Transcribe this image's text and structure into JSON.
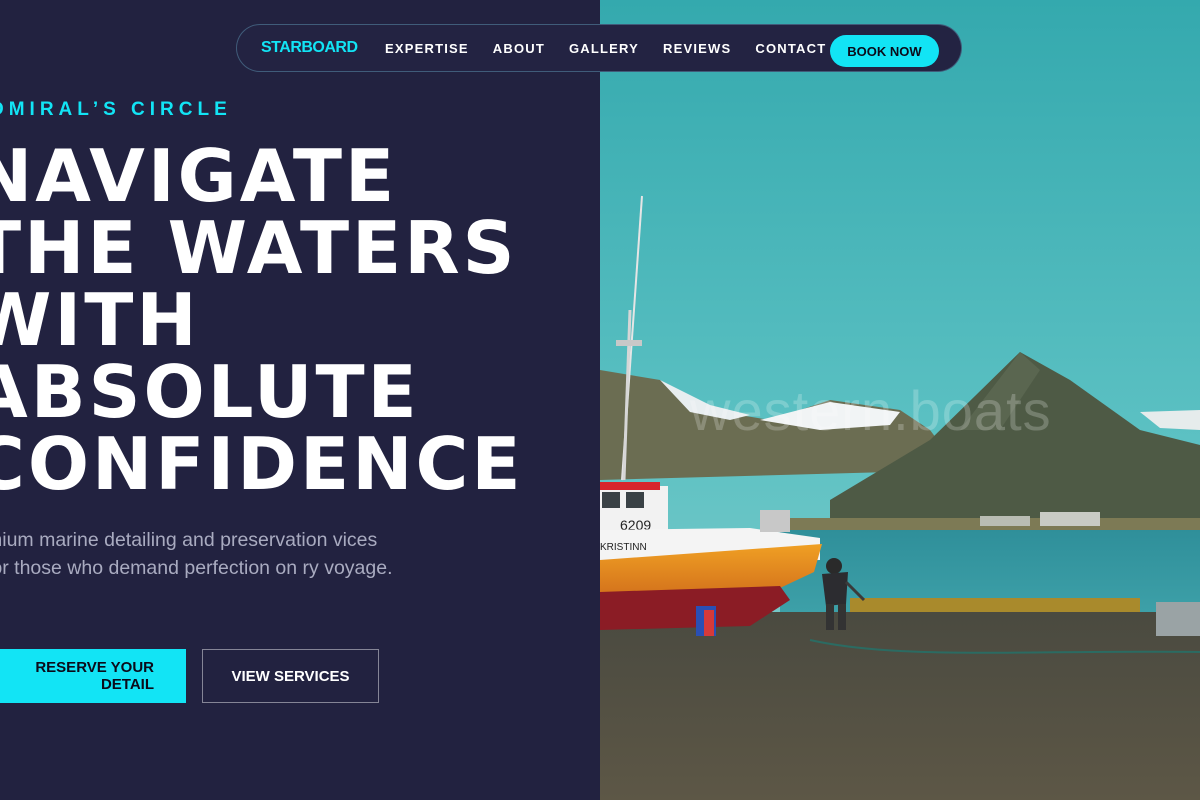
{
  "nav": {
    "brand": "STARBOARD",
    "links": [
      "EXPERTISE",
      "ABOUT",
      "GALLERY",
      "REVIEWS",
      "CONTACT"
    ],
    "cta": "BOOK NOW"
  },
  "hero": {
    "eyebrow": "DMIRAL’S CIRCLE",
    "headline": [
      "NAVIGATE",
      "THE WATERS",
      "WITH",
      "ABSOLUTE",
      "CONFIDENCE"
    ],
    "subtext": "mium marine detailing and preservation vices for those who demand perfection on ry voyage.",
    "primary_cta": "RESERVE YOUR DETAIL",
    "secondary_cta": "VIEW SERVICES"
  },
  "image": {
    "watermark": "western.boats",
    "boat_number": "6209",
    "boat_name": "KRISTINN"
  },
  "colors": {
    "accent": "#12e4f5",
    "panel": "#222240",
    "sky": "#3fb2b6"
  }
}
